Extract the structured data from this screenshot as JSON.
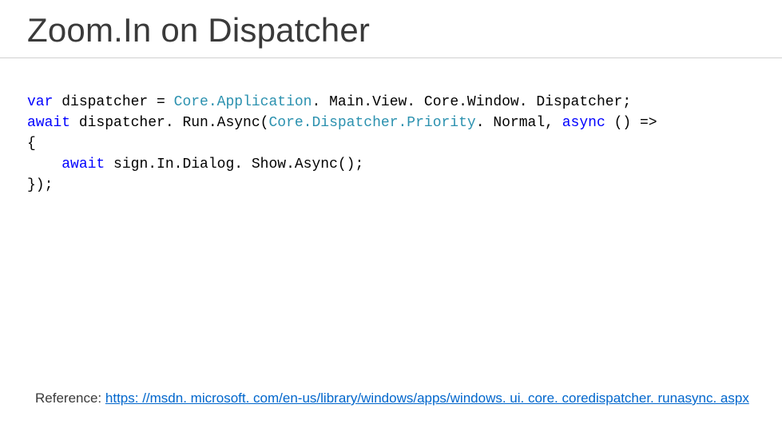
{
  "title": "Zoom.In on Dispatcher",
  "code": {
    "kw_var": "var",
    "sp": " ",
    "t1": "dispatcher = ",
    "type_CoreApplication": "Core.Application",
    "t2": ". Main.View. Core.Window. Dispatcher;",
    "nl": "\n",
    "kw_await1": "await",
    "t3": " dispatcher. Run.Async(",
    "type_CoreDispatcherPriority": "Core.Dispatcher.Priority",
    "t4": ". Normal, ",
    "kw_async": "async",
    "t5": " () =>",
    "t6": "{",
    "indent": "    ",
    "kw_await2": "await",
    "t7": " sign.In.Dialog. Show.Async();",
    "t8": "});"
  },
  "footer": {
    "label": "Reference: ",
    "url": "https: //msdn. microsoft. com/en-us/library/windows/apps/windows. ui. core. coredispatcher. runasync. aspx"
  }
}
